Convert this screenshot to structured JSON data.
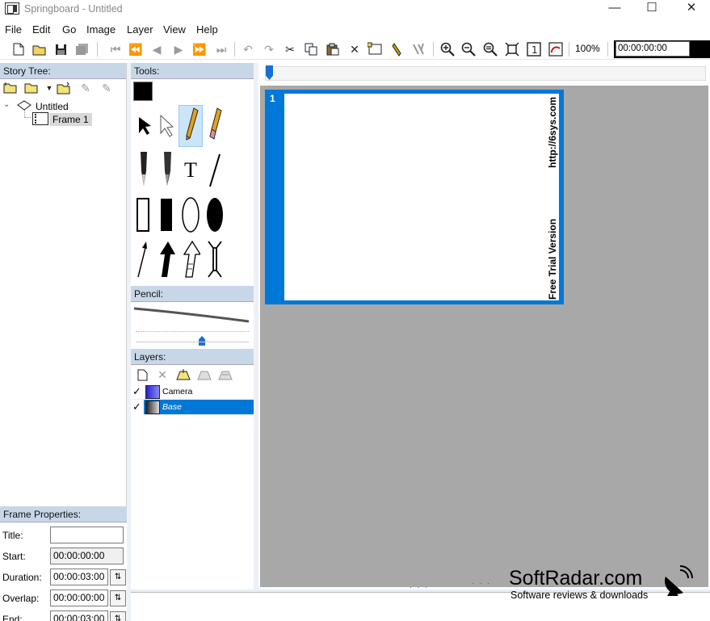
{
  "window": {
    "title": "Springboard - Untitled",
    "minimize": "—",
    "maximize": "☐",
    "close": "✕"
  },
  "menu": [
    "File",
    "Edit",
    "Go",
    "Image",
    "Layer",
    "View",
    "Help"
  ],
  "toolbar": {
    "zoom": "100%",
    "time": "00:00:00:00"
  },
  "story_tree": {
    "header": "Story Tree:",
    "root": "Untitled",
    "frame": "Frame 1"
  },
  "tools": {
    "header": "Tools:",
    "text_tool_glyph": "T"
  },
  "pencil": {
    "header": "Pencil:"
  },
  "layers": {
    "header": "Layers:",
    "items": [
      {
        "name": "Camera",
        "checked": true,
        "selected": false
      },
      {
        "name": "Base",
        "checked": true,
        "selected": true
      }
    ]
  },
  "frame_properties": {
    "header": "Frame Properties:",
    "title_label": "Title:",
    "title_value": "",
    "start_label": "Start:",
    "start_value": "00:00:00:00",
    "duration_label": "Duration:",
    "duration_value": "00:00:03:00",
    "overlap_label": "Overlap:",
    "overlap_value": "00:00:00:00",
    "end_label": "End:",
    "end_value": "00:00:03:00"
  },
  "canvas": {
    "frame_number": "1",
    "watermark_url": "http://6sys.com",
    "watermark_trial": "Free Trial Version"
  },
  "branding": {
    "name": "SoftRadar.com",
    "tagline": "Software reviews & downloads"
  },
  "colors": {
    "accent": "#0078d7",
    "panel_header": "#c8d7e8",
    "stage": "#a8a8a8"
  }
}
